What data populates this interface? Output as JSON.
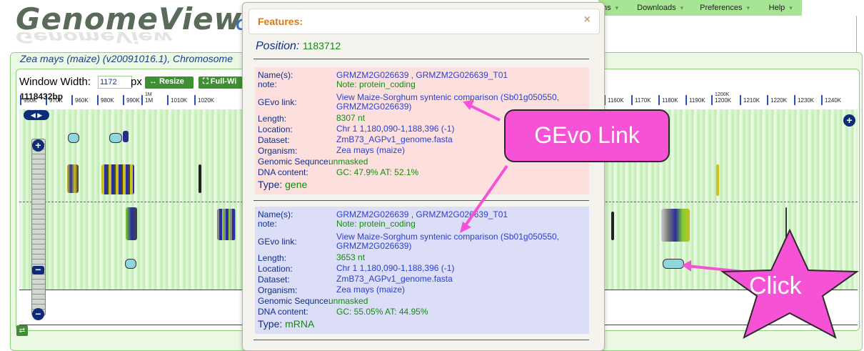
{
  "app": {
    "logo": "GenomeView",
    "logo_tail": "C",
    "nav": [
      "ns",
      "Downloads",
      "Preferences",
      "Help"
    ]
  },
  "panel_title": "Zea mays (maize) (v20091016.1), Chromosome",
  "controls": {
    "window_width_label": "Window Width:",
    "window_width_value": "1172",
    "px_label": "px",
    "resize_label": "↔ Resize",
    "full_label": "⛶ Full-Wi",
    "coordinate": "1118432bp"
  },
  "ruler_ticks": [
    "950K",
    "960K",
    "970K",
    "980K",
    "990K",
    "1M",
    "1010K",
    "1020K",
    "1160K",
    "1170K",
    "1180K",
    "1190K",
    "1200K",
    "1210K",
    "1220K",
    "1230K",
    "1240K"
  ],
  "popup": {
    "title": "Features:",
    "close": "×",
    "position_label": "Position:",
    "position_value": "1183712",
    "labels": {
      "names": "Name(s):",
      "note": "note:",
      "gevo": "GEvo link:",
      "length": "Length:",
      "location": "Location:",
      "dataset": "Dataset:",
      "organism": "Organism:",
      "genomic": "Genomic Sequnce:",
      "dna": "DNA content:",
      "type": "Type:"
    },
    "features": [
      {
        "names": "GRMZM2G026639 , GRMZM2G026639_T01",
        "note": "Note: protein_coding",
        "gevo_1": "View Maize-Sorghum syntenic comparison (Sb01g050550,",
        "gevo_2": "GRMZM2G026639)",
        "length": "8307 nt",
        "location": "Chr 1 1,180,090-1,188,396 (-1)",
        "dataset": "ZmB73_AGPv1_genome.fasta",
        "organism": "Zea mays (maize)",
        "genomic": "unmasked",
        "dna": "GC: 47.9% AT: 52.1%",
        "type": "gene"
      },
      {
        "names": "GRMZM2G026639 , GRMZM2G026639_T01",
        "note": "Note: protein_coding",
        "gevo_1": "View Maize-Sorghum syntenic comparison (Sb01g050550,",
        "gevo_2": "GRMZM2G026639)",
        "length": "3653 nt",
        "location": "Chr 1 1,180,090-1,188,396 (-1)",
        "dataset": "ZmB73_AGPv1_genome.fasta",
        "organism": "Zea mays (maize)",
        "genomic": "unmasked",
        "dna": "GC: 55.05% AT: 44.95%",
        "type": "mRNA"
      }
    ]
  },
  "annotations": {
    "gevo_callout": "GEvo Link",
    "click_callout": "Click"
  },
  "colors": {
    "accent_green": "#3f8f33",
    "nav_green": "#a7e494",
    "callout_pink": "#f652d6",
    "feature_orange": "#d47a18"
  }
}
